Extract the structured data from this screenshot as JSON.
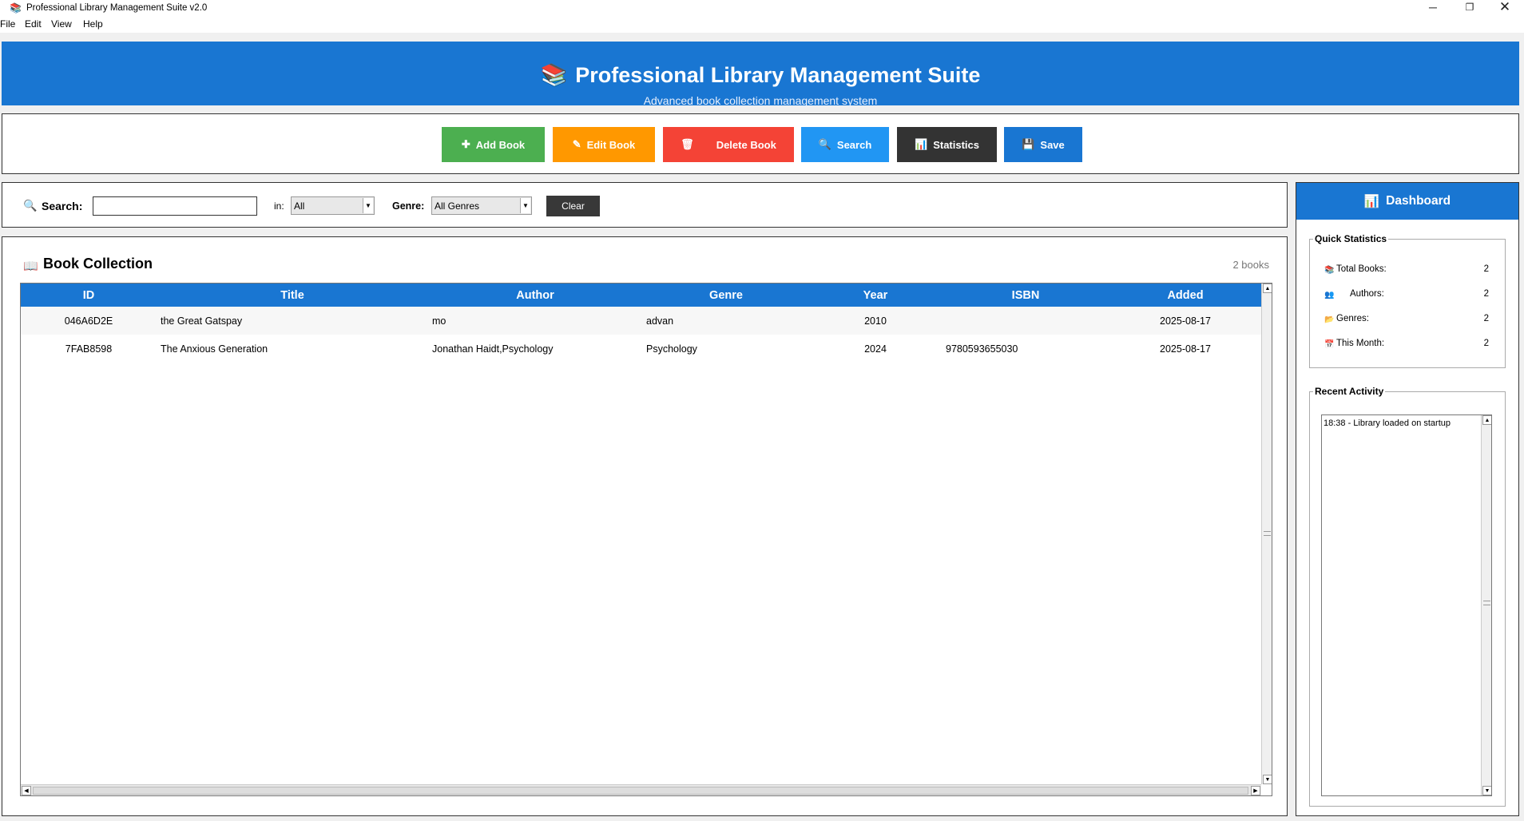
{
  "window": {
    "title": "Professional Library Management Suite v2.0",
    "icon": "books-icon",
    "controls": {
      "minimize": "─",
      "maximize": "❐",
      "close": "✕"
    }
  },
  "menu": [
    "File",
    "Edit",
    "View",
    "Help"
  ],
  "header": {
    "icon": "📚",
    "title": "Professional Library Management Suite",
    "subtitle": "Advanced book collection management system"
  },
  "toolbar": {
    "buttons": [
      {
        "icon": "✚",
        "label": "Add Book",
        "color": "#4caf50"
      },
      {
        "icon": "✎",
        "label": "Edit Book",
        "color": "#ff9800"
      },
      {
        "icon": "🗑",
        "label": "Delete Book",
        "color": "#f44336"
      },
      {
        "icon": "🔍",
        "label": "Search",
        "color": "#2196f3"
      },
      {
        "icon": "📊",
        "label": "Statistics",
        "color": "#333333"
      },
      {
        "icon": "💾",
        "label": "Save",
        "color": "#1976d2"
      }
    ]
  },
  "search": {
    "icon": "🔍",
    "label": "Search:",
    "value": "",
    "in_label": "in:",
    "in_value": "All",
    "genre_label": "Genre:",
    "genre_value": "All Genres",
    "clear_label": "Clear"
  },
  "collection": {
    "icon": "📖",
    "title": "Book Collection",
    "count": "2 books",
    "columns": [
      "ID",
      "Title",
      "Author",
      "Genre",
      "Year",
      "ISBN",
      "Added"
    ],
    "rows": [
      [
        "046A6D2E",
        "the Great Gatspay",
        "mo",
        "advan",
        "2010",
        "",
        "2025-08-17"
      ],
      [
        "7FAB8598",
        "The Anxious Generation",
        "Jonathan Haidt,Psychology",
        "Psychology",
        "2024",
        "9780593655030",
        "2025-08-17"
      ]
    ]
  },
  "dashboard": {
    "icon": "📊",
    "title": "Dashboard",
    "quick_stats_title": "Quick Statistics",
    "stats": [
      {
        "icon": "📚",
        "label": "Total Books:",
        "value": "2"
      },
      {
        "icon": "👥",
        "label": "Authors:",
        "value": "2"
      },
      {
        "icon": "📂",
        "label": "Genres:",
        "value": "2"
      },
      {
        "icon": "📅",
        "label": "This Month:",
        "value": "2"
      }
    ],
    "activity_title": "Recent Activity",
    "activity": [
      "18:38 - Library loaded on startup"
    ]
  },
  "colors": {
    "accent": "#1976d2",
    "add": "#4caf50",
    "edit": "#ff9800",
    "delete": "#f44336",
    "search": "#2196f3",
    "statistics": "#333333",
    "save": "#1976d2"
  }
}
